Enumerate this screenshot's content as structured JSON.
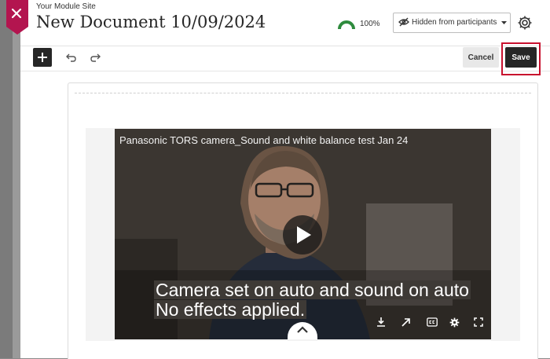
{
  "header": {
    "site_name": "Your Module Site",
    "title": "New Document 10/09/2024",
    "progress": {
      "value": 100,
      "label": "100%",
      "color": "#2e8b3d"
    },
    "visibility": {
      "label": "Hidden from participants"
    }
  },
  "toolbar": {
    "cancel_label": "Cancel",
    "save_label": "Save"
  },
  "video": {
    "title": "Panasonic TORS camera_Sound and white balance test Jan 24",
    "captions": [
      "Camera set on auto and sound on auto",
      "No effects applied."
    ],
    "controls": [
      "download-icon",
      "share-icon",
      "closed-captions-icon",
      "gear-icon",
      "fullscreen-icon"
    ]
  },
  "colors": {
    "accent": "#c8102e",
    "dark": "#262626",
    "progress": "#2e8b3d"
  }
}
